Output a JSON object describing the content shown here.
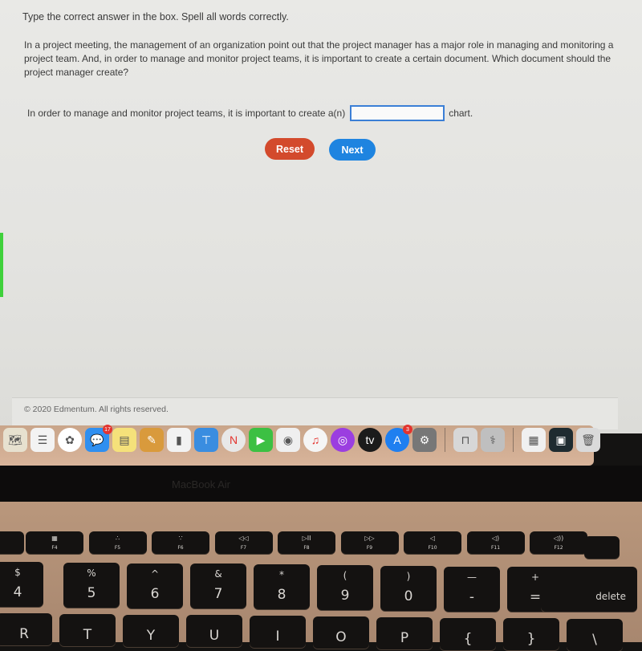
{
  "question_page": {
    "instructions": "Type the correct answer in the box. Spell all words correctly.",
    "question": "In a project meeting, the management of an organization point out that the project manager has a major role in managing and monitoring a project team. And, in order to manage and monitor project teams, it is important to create a certain document. Which document should the project manager create?",
    "answer_prefix": "In order to manage and monitor project teams, it is important to create a(n)",
    "answer_value": "",
    "answer_suffix": "chart.",
    "reset_label": "Reset",
    "next_label": "Next",
    "copyright": "© 2020 Edmentum. All rights reserved.",
    "colors": {
      "reset": "#d34a2c",
      "next": "#1e84e0",
      "input_border": "#3b7fd6"
    }
  },
  "dock": {
    "items": [
      {
        "name": "maps",
        "glyph": "🗺"
      },
      {
        "name": "reminders",
        "glyph": "☰"
      },
      {
        "name": "photos",
        "glyph": "✿"
      },
      {
        "name": "messages",
        "glyph": "💬",
        "badge": "17"
      },
      {
        "name": "notes",
        "glyph": "▤"
      },
      {
        "name": "pages",
        "glyph": "✎"
      },
      {
        "name": "numbers",
        "glyph": "▮"
      },
      {
        "name": "keynote",
        "glyph": "⊤"
      },
      {
        "name": "news",
        "glyph": "N"
      },
      {
        "name": "facetime",
        "glyph": "▶"
      },
      {
        "name": "screenshot",
        "glyph": "◉"
      },
      {
        "name": "music",
        "glyph": "♫"
      },
      {
        "name": "podcasts",
        "glyph": "◎"
      },
      {
        "name": "apple-tv",
        "glyph": "tv"
      },
      {
        "name": "app-store",
        "glyph": "A",
        "badge": "3"
      },
      {
        "name": "system-preferences",
        "glyph": "⚙"
      },
      {
        "name": "system-information",
        "glyph": "⊓"
      },
      {
        "name": "disk-utility",
        "glyph": "⚕"
      },
      {
        "name": "document-window",
        "glyph": "▦"
      },
      {
        "name": "safari-window",
        "glyph": "▣"
      },
      {
        "name": "trash",
        "glyph": "🗑"
      }
    ]
  },
  "device": {
    "label": "MacBook Air"
  },
  "keyboard": {
    "function_keys": [
      {
        "sym": "▦",
        "label": "F4"
      },
      {
        "sym": "∴",
        "label": "F5"
      },
      {
        "sym": "∵",
        "label": "F6"
      },
      {
        "sym": "◁◁",
        "label": "F7"
      },
      {
        "sym": "▷II",
        "label": "F8"
      },
      {
        "sym": "▷▷",
        "label": "F9"
      },
      {
        "sym": "◁",
        "label": "F10"
      },
      {
        "sym": "◁)",
        "label": "F11"
      },
      {
        "sym": "◁))",
        "label": "F12"
      }
    ],
    "number_keys": [
      {
        "top": "$",
        "bot": "4"
      },
      {
        "top": "%",
        "bot": "5"
      },
      {
        "top": "^",
        "bot": "6"
      },
      {
        "top": "&",
        "bot": "7"
      },
      {
        "top": "*",
        "bot": "8"
      },
      {
        "top": "(",
        "bot": "9"
      },
      {
        "top": ")",
        "bot": "0"
      },
      {
        "top": "—",
        "bot": "-"
      },
      {
        "top": "+",
        "bot": "="
      }
    ],
    "delete_label": "delete",
    "letter_keys": [
      "R",
      "T",
      "Y",
      "U",
      "I",
      "O",
      "P",
      "{",
      "}",
      "\\"
    ]
  }
}
